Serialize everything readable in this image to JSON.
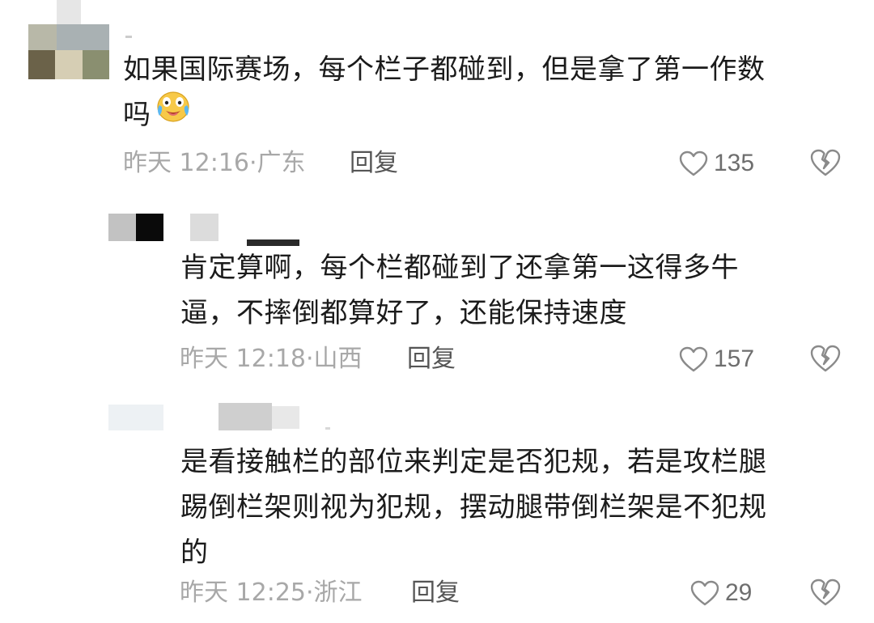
{
  "comments": [
    {
      "text_line1": "如果国际赛场，每个栏子都碰到，但是拿了第一作数",
      "text_line2": "吗",
      "emoji": "crying-laughing-face-icon",
      "time": "昨天 12:16",
      "location": "广东",
      "reply_label": "回复",
      "likes": "135"
    },
    {
      "text_line1": "肯定算啊，每个栏都碰到了还拿第一这得多牛",
      "text_line2": "逼，不摔倒都算好了，还能保持速度",
      "time": "昨天 12:18",
      "location": "山西",
      "reply_label": "回复",
      "likes": "157"
    },
    {
      "text_line1": "是看接触栏的部位来判定是否犯规，若是攻栏腿",
      "text_line2": "踢倒栏架则视为犯规，摆动腿带倒栏架是不犯规",
      "text_line3": "的",
      "time": "昨天 12:25",
      "location": "浙江",
      "reply_label": "回复",
      "likes": "29"
    }
  ],
  "colors": {
    "meta": "#a8a8a8",
    "reply": "#555555",
    "text": "#1b1b1b"
  }
}
